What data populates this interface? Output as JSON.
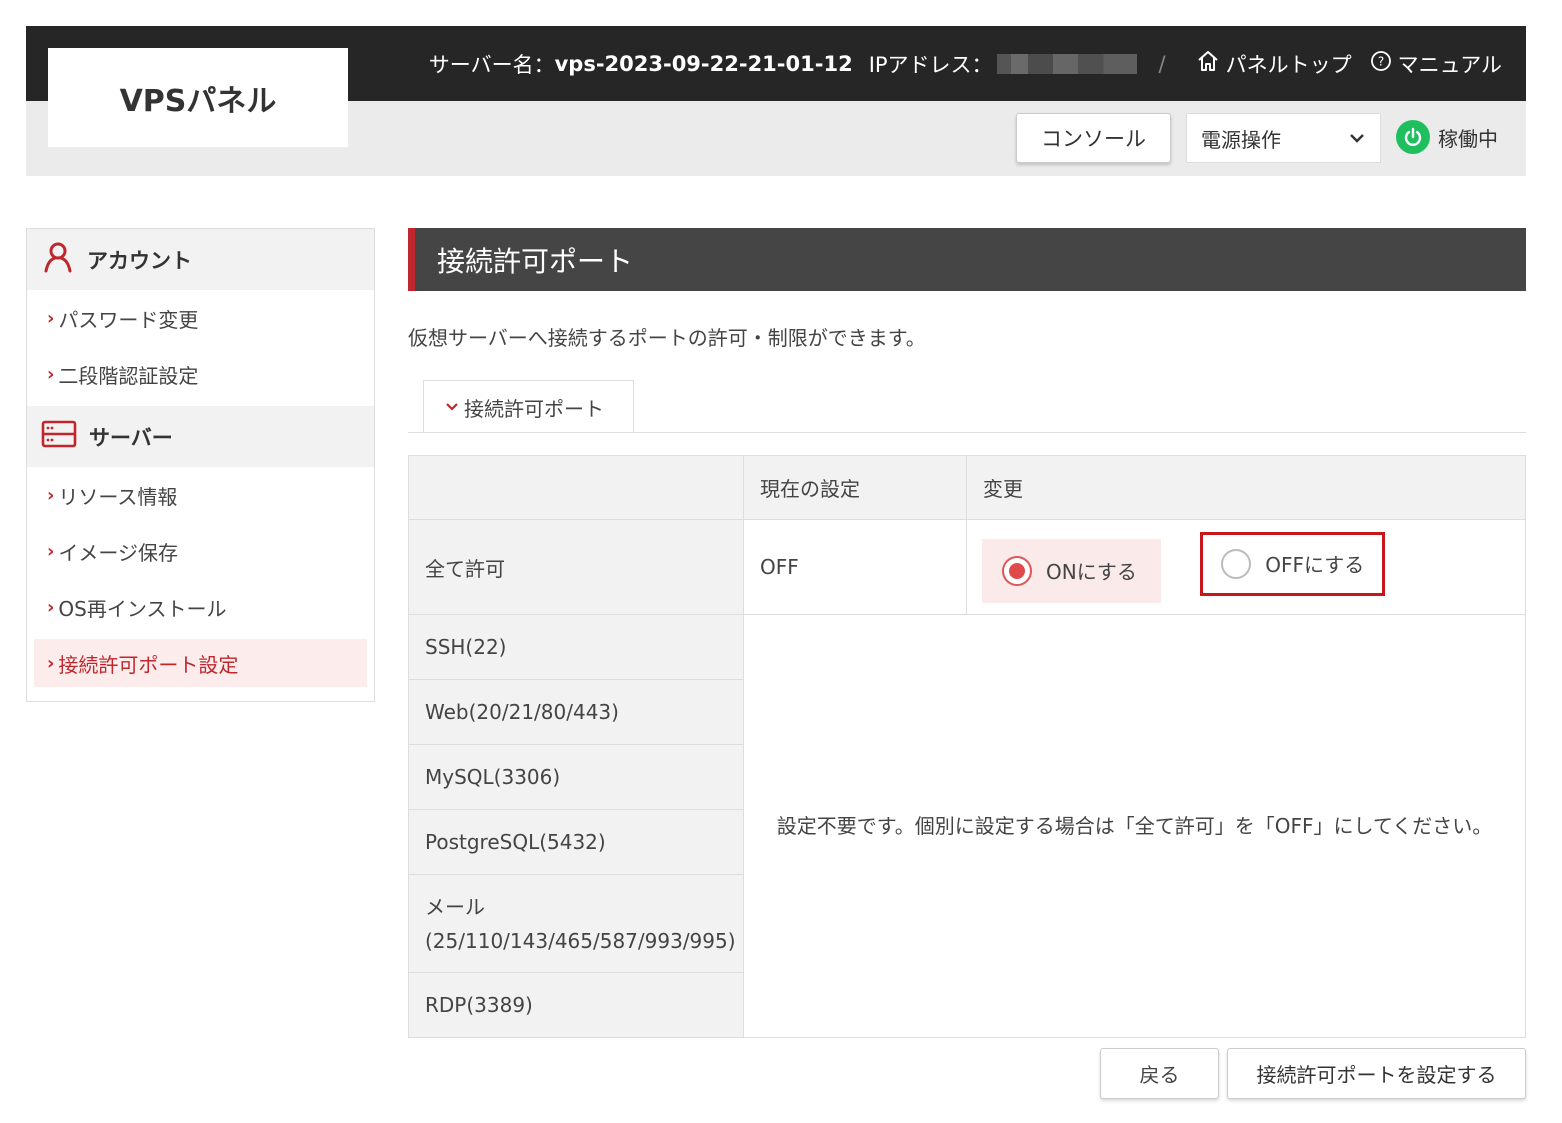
{
  "header": {
    "logo": "VPSパネル",
    "server_name_label": "サーバー名：",
    "server_name_value": "vps-2023-09-22-21-01-12",
    "ip_label": "IPアドレス：",
    "separator": "/",
    "panel_top": "パネルトップ",
    "manual": "マニュアル",
    "console_button": "コンソール",
    "power_select_value": "電源操作",
    "status_text": "稼働中",
    "status_color": "#1fbf5f"
  },
  "sidebar": {
    "sections": [
      {
        "title": "アカウント",
        "icon": "user-icon",
        "items": [
          "パスワード変更",
          "二段階認証設定"
        ]
      },
      {
        "title": "サーバー",
        "icon": "server-icon",
        "items": [
          "リソース情報",
          "イメージ保存",
          "OS再インストール",
          "接続許可ポート設定"
        ]
      }
    ],
    "active_item": "接続許可ポート設定"
  },
  "main": {
    "title": "接続許可ポート",
    "description": "仮想サーバーへ接続するポートの許可・制限ができます。",
    "tab_label": "接続許可ポート",
    "table": {
      "col_current": "現在の設定",
      "col_change": "変更",
      "all_allow_label": "全て許可",
      "all_allow_current": "OFF",
      "radio_on_label": "ONにする",
      "radio_off_label": "OFFにする",
      "radio_selected": "ON",
      "ports": [
        "SSH(22)",
        "Web(20/21/80/443)",
        "MySQL(3306)",
        "PostgreSQL(5432)",
        "メール",
        "(25/110/143/465/587/993/995)",
        "RDP(3389)"
      ],
      "note": "設定不要です。個別に設定する場合は「全て許可」を「OFF」にしてください。"
    },
    "back_button": "戻る",
    "submit_button": "接続許可ポートを設定する"
  },
  "colors": {
    "accent": "#c0272d",
    "header_bg": "#262626",
    "title_bg": "#454545",
    "highlight_border": "#c8161d"
  }
}
